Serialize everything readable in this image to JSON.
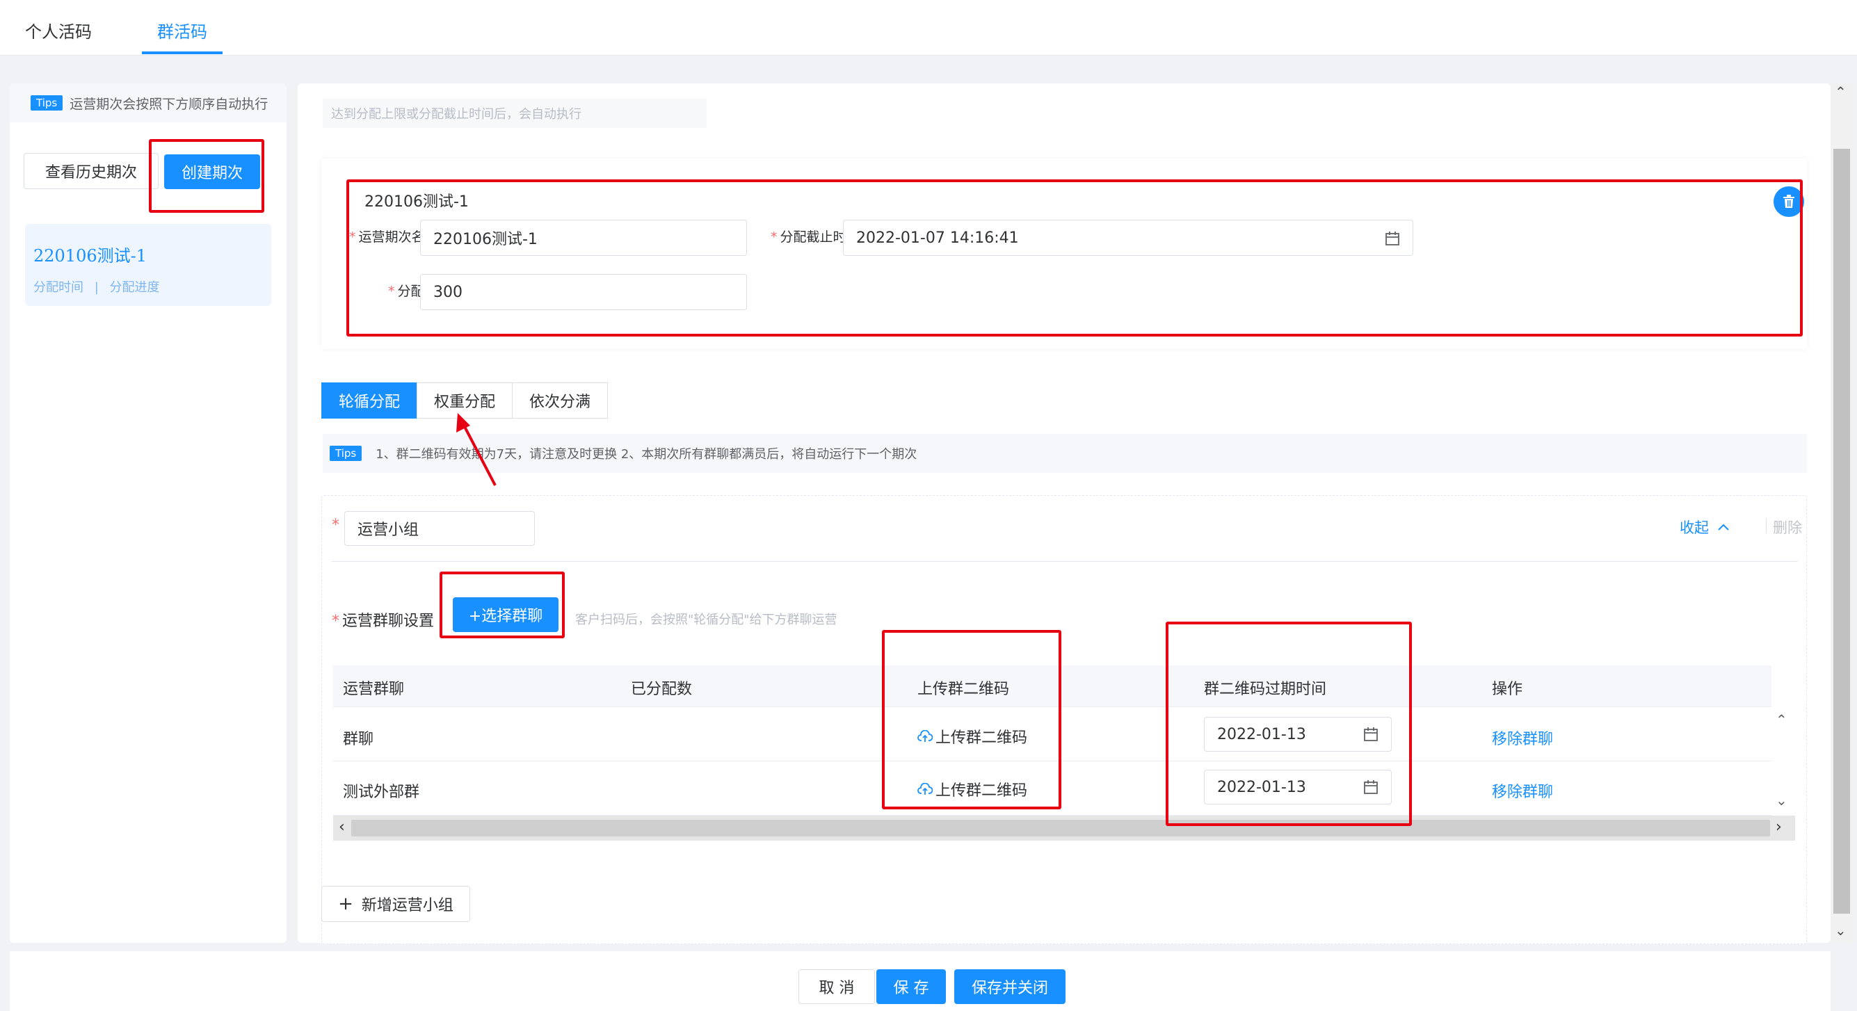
{
  "top_tabs": [
    {
      "label": "个人活码"
    },
    {
      "label": "群活码"
    }
  ],
  "left": {
    "tips_badge": "Tips",
    "tips_text": "运营期次会按照下方顺序自动执行",
    "history_button": "查看历史期次",
    "create_button": "创建期次",
    "period_card": {
      "title": "220106测试-1",
      "meta_time": "分配时间",
      "meta_sep": "|",
      "meta_progress": "分配进度"
    }
  },
  "right": {
    "hint": "达到分配上限或分配截止时间后，会自动执行",
    "period": {
      "name": "220106测试-1",
      "name_label": "运营期次名称",
      "name_value": "220106测试-1",
      "deadline_label": "分配截止时间",
      "deadline_value": "2022-01-07 14:16:41",
      "limit_label": "分配上限",
      "limit_value": "300",
      "required_mark": "*"
    },
    "strategy_tabs": [
      {
        "label": "轮循分配"
      },
      {
        "label": "权重分配"
      },
      {
        "label": "依次分满"
      }
    ],
    "tips_badge": "Tips",
    "tips_text": "1、群二维码有效期为7天，请注意及时更换 2、本期次所有群聊都满员后，将自动运行下一个期次",
    "group": {
      "name_value": "运营小组",
      "collapse_label": "收起",
      "delete_label": "删除",
      "chat_setting_label": "运营群聊设置",
      "select_button": "+选择群聊",
      "chat_hint": "客户扫码后，会按照\"轮循分配\"给下方群聊运营",
      "table": {
        "headers": [
          "运营群聊",
          "已分配数",
          "上传群二维码",
          "群二维码过期时间",
          "操作"
        ],
        "rows": [
          {
            "chat": "群聊",
            "assigned": "",
            "upload": "上传群二维码",
            "expire": "2022-01-13",
            "action": "移除群聊"
          },
          {
            "chat": "测试外部群",
            "assigned": "",
            "upload": "上传群二维码",
            "expire": "2022-01-13",
            "action": "移除群聊"
          }
        ]
      }
    },
    "add_group_button": "新增运营小组"
  },
  "footer": {
    "cancel": "取 消",
    "save": "保 存",
    "save_close": "保存并关闭"
  },
  "colors": {
    "accent": "#1890ff",
    "annotation": "#e60012",
    "required": "#f56c6c"
  }
}
